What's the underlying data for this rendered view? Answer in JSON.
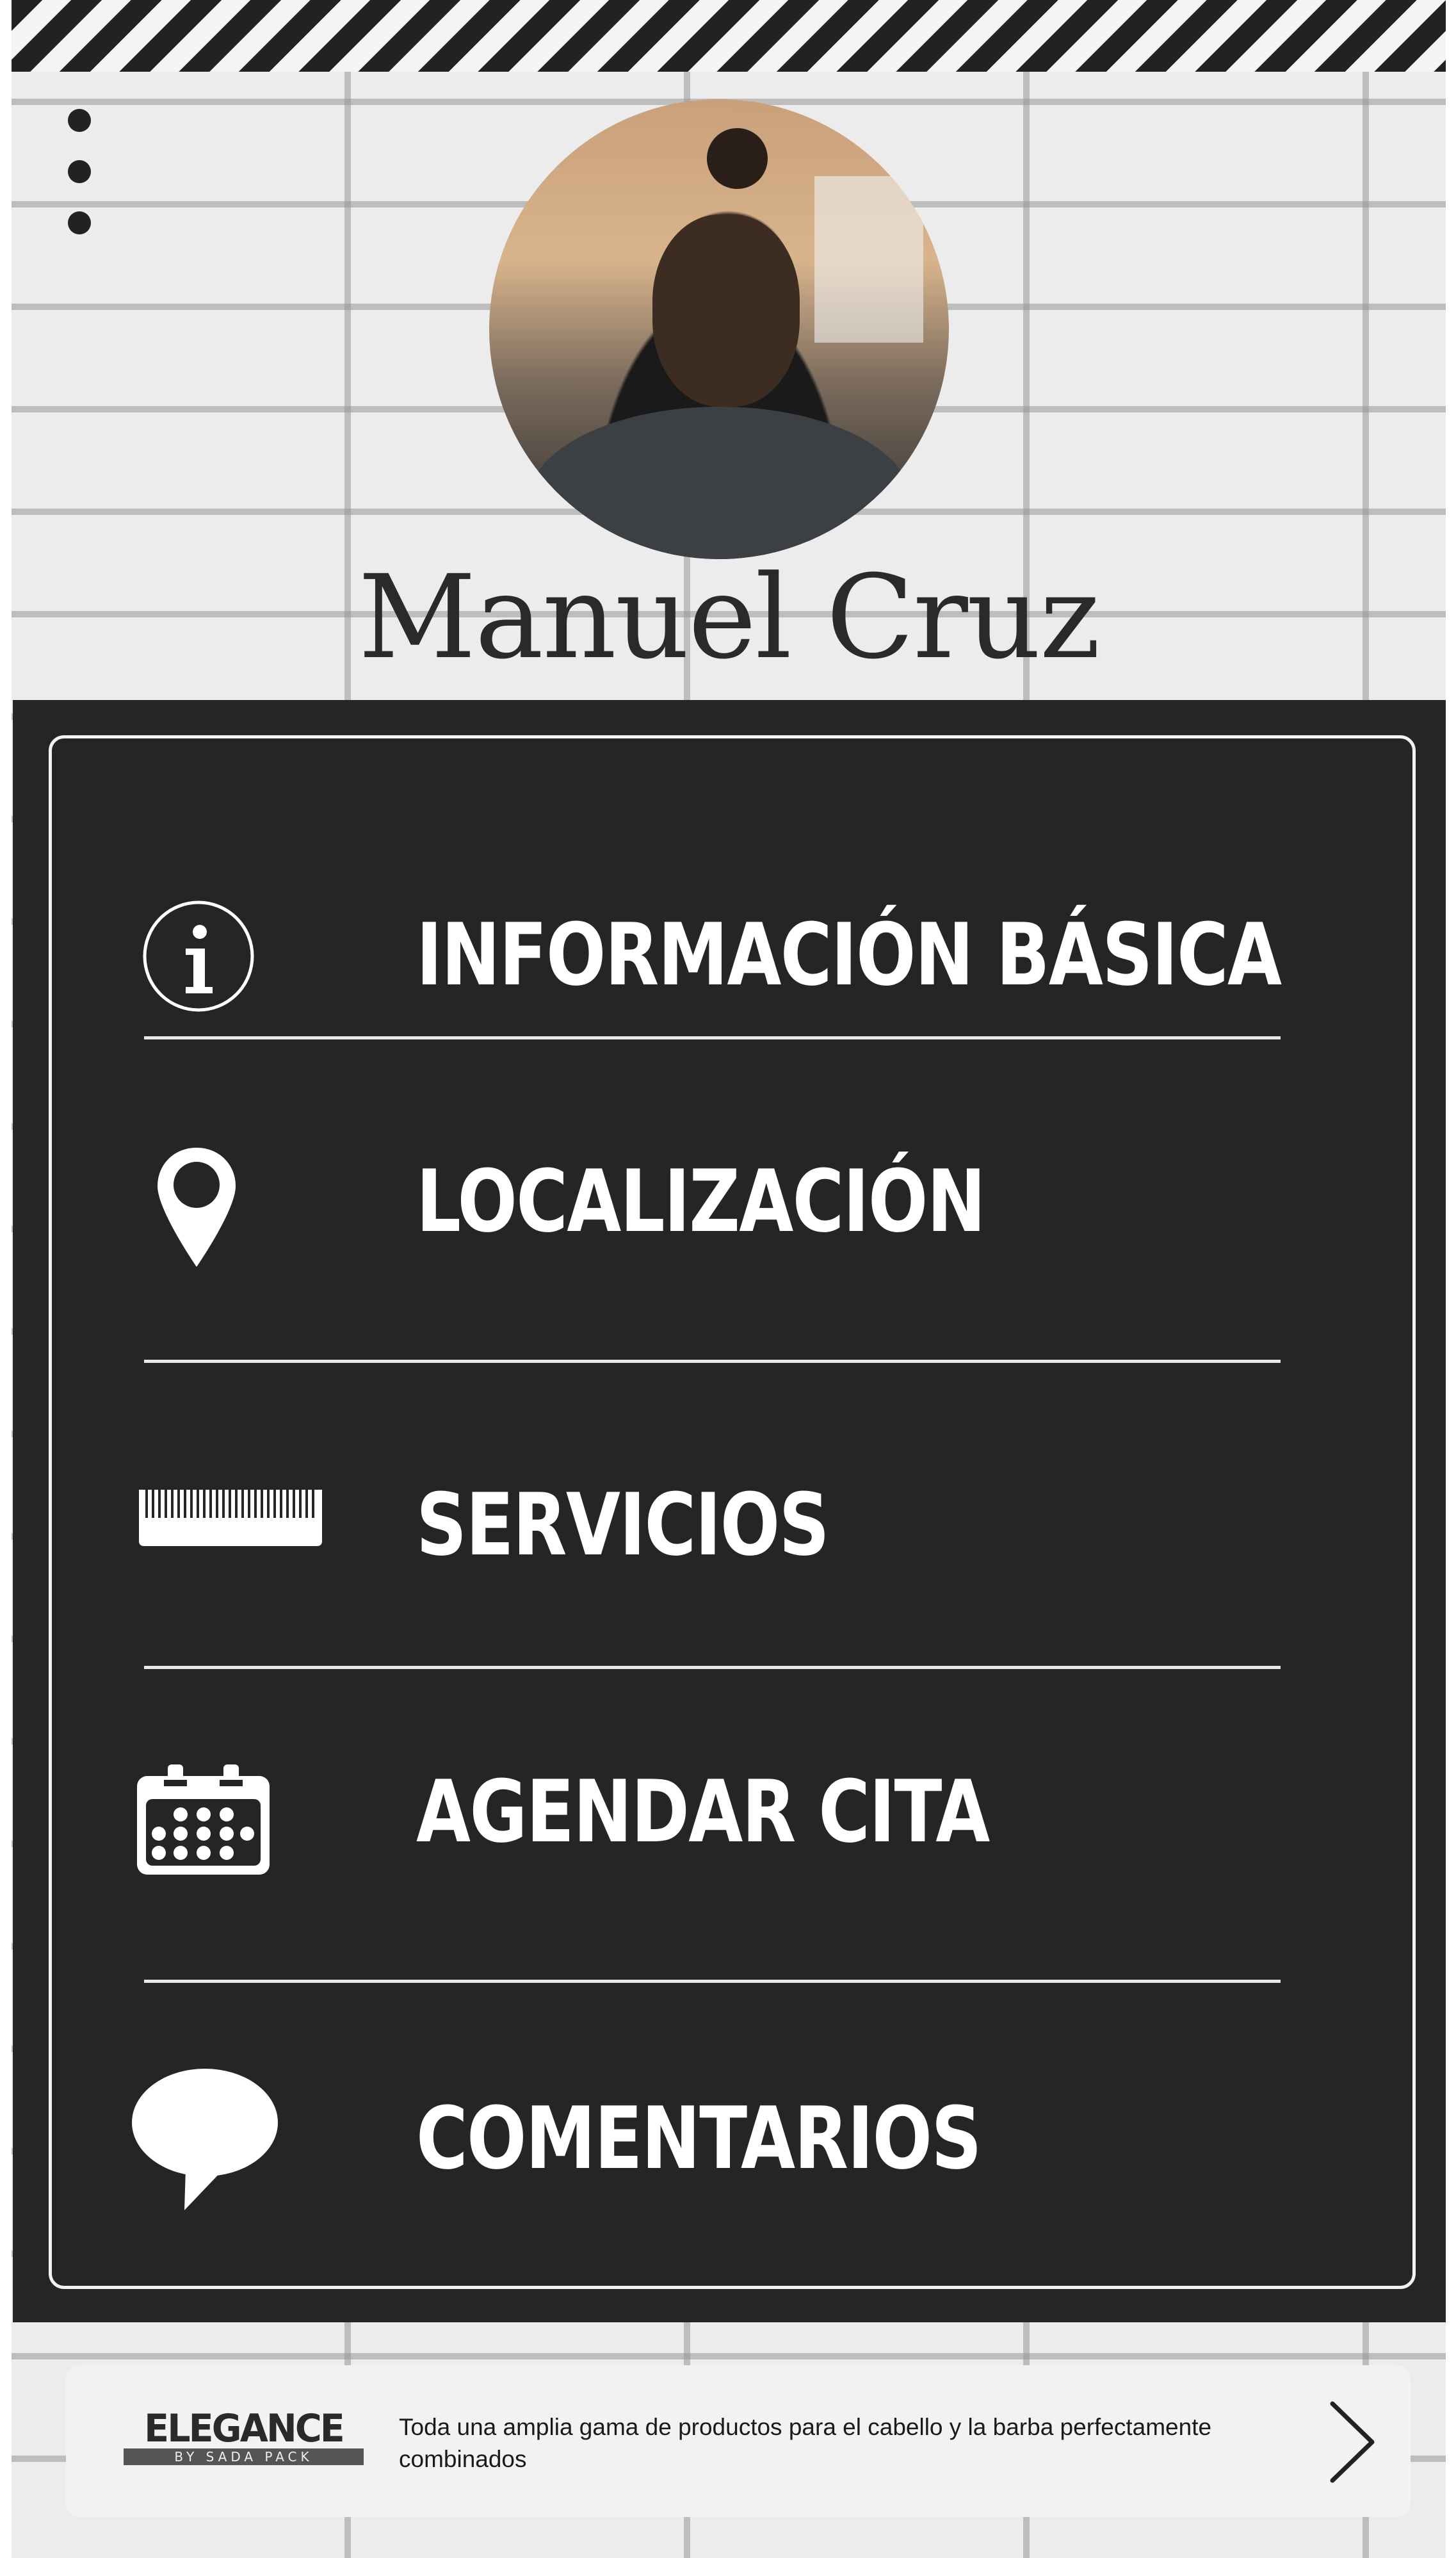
{
  "profile": {
    "name": "Manuel Cruz",
    "photo": "profile-photo"
  },
  "menu": {
    "items": [
      {
        "label": "INFORMACIÓN BÁSICA",
        "icon": "info-icon"
      },
      {
        "label": "LOCALIZACIÓN",
        "icon": "location-pin-icon"
      },
      {
        "label": "SERVICIOS",
        "icon": "comb-icon"
      },
      {
        "label": "AGENDAR CITA",
        "icon": "calendar-icon"
      },
      {
        "label": "COMENTARIOS",
        "icon": "speech-bubble-icon"
      }
    ]
  },
  "banner": {
    "brand": "ELEGANCE",
    "brand_sub": "BY SADA PACK",
    "text": "Toda una amplia gama de productos para el cabello y la barba perfectamente combinados",
    "arrow_icon": "chevron-right-icon"
  },
  "colors": {
    "panel": "#262526",
    "stripe_dark": "#222222",
    "text_light": "#ffffff",
    "text_dark": "#2a2a2a"
  }
}
